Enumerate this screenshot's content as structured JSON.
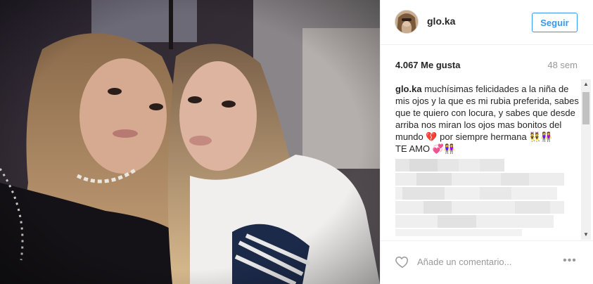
{
  "post": {
    "username": "glo.ka",
    "follow_label": "Seguir",
    "likes": "4.067 Me gusta",
    "time_ago": "48 sem",
    "caption_user": "glo.ka",
    "caption_text": " muchísimas felicidades a la niña de mis ojos y la que es mi rubia preferida, sabes que te quiero con locura, y sabes que desde arriba nos miran los ojos mas bonitos del mundo 💔 por siempre hermana 👯👭\nTE AMO 💞👭",
    "comment_placeholder": "Añade un comentario...",
    "more_label": "•••"
  },
  "scrollbar": {
    "up_arrow": "▲",
    "down_arrow": "▼"
  },
  "colors": {
    "accent": "#3897f0",
    "text": "#262626",
    "muted": "#999999",
    "border": "#efefef"
  }
}
